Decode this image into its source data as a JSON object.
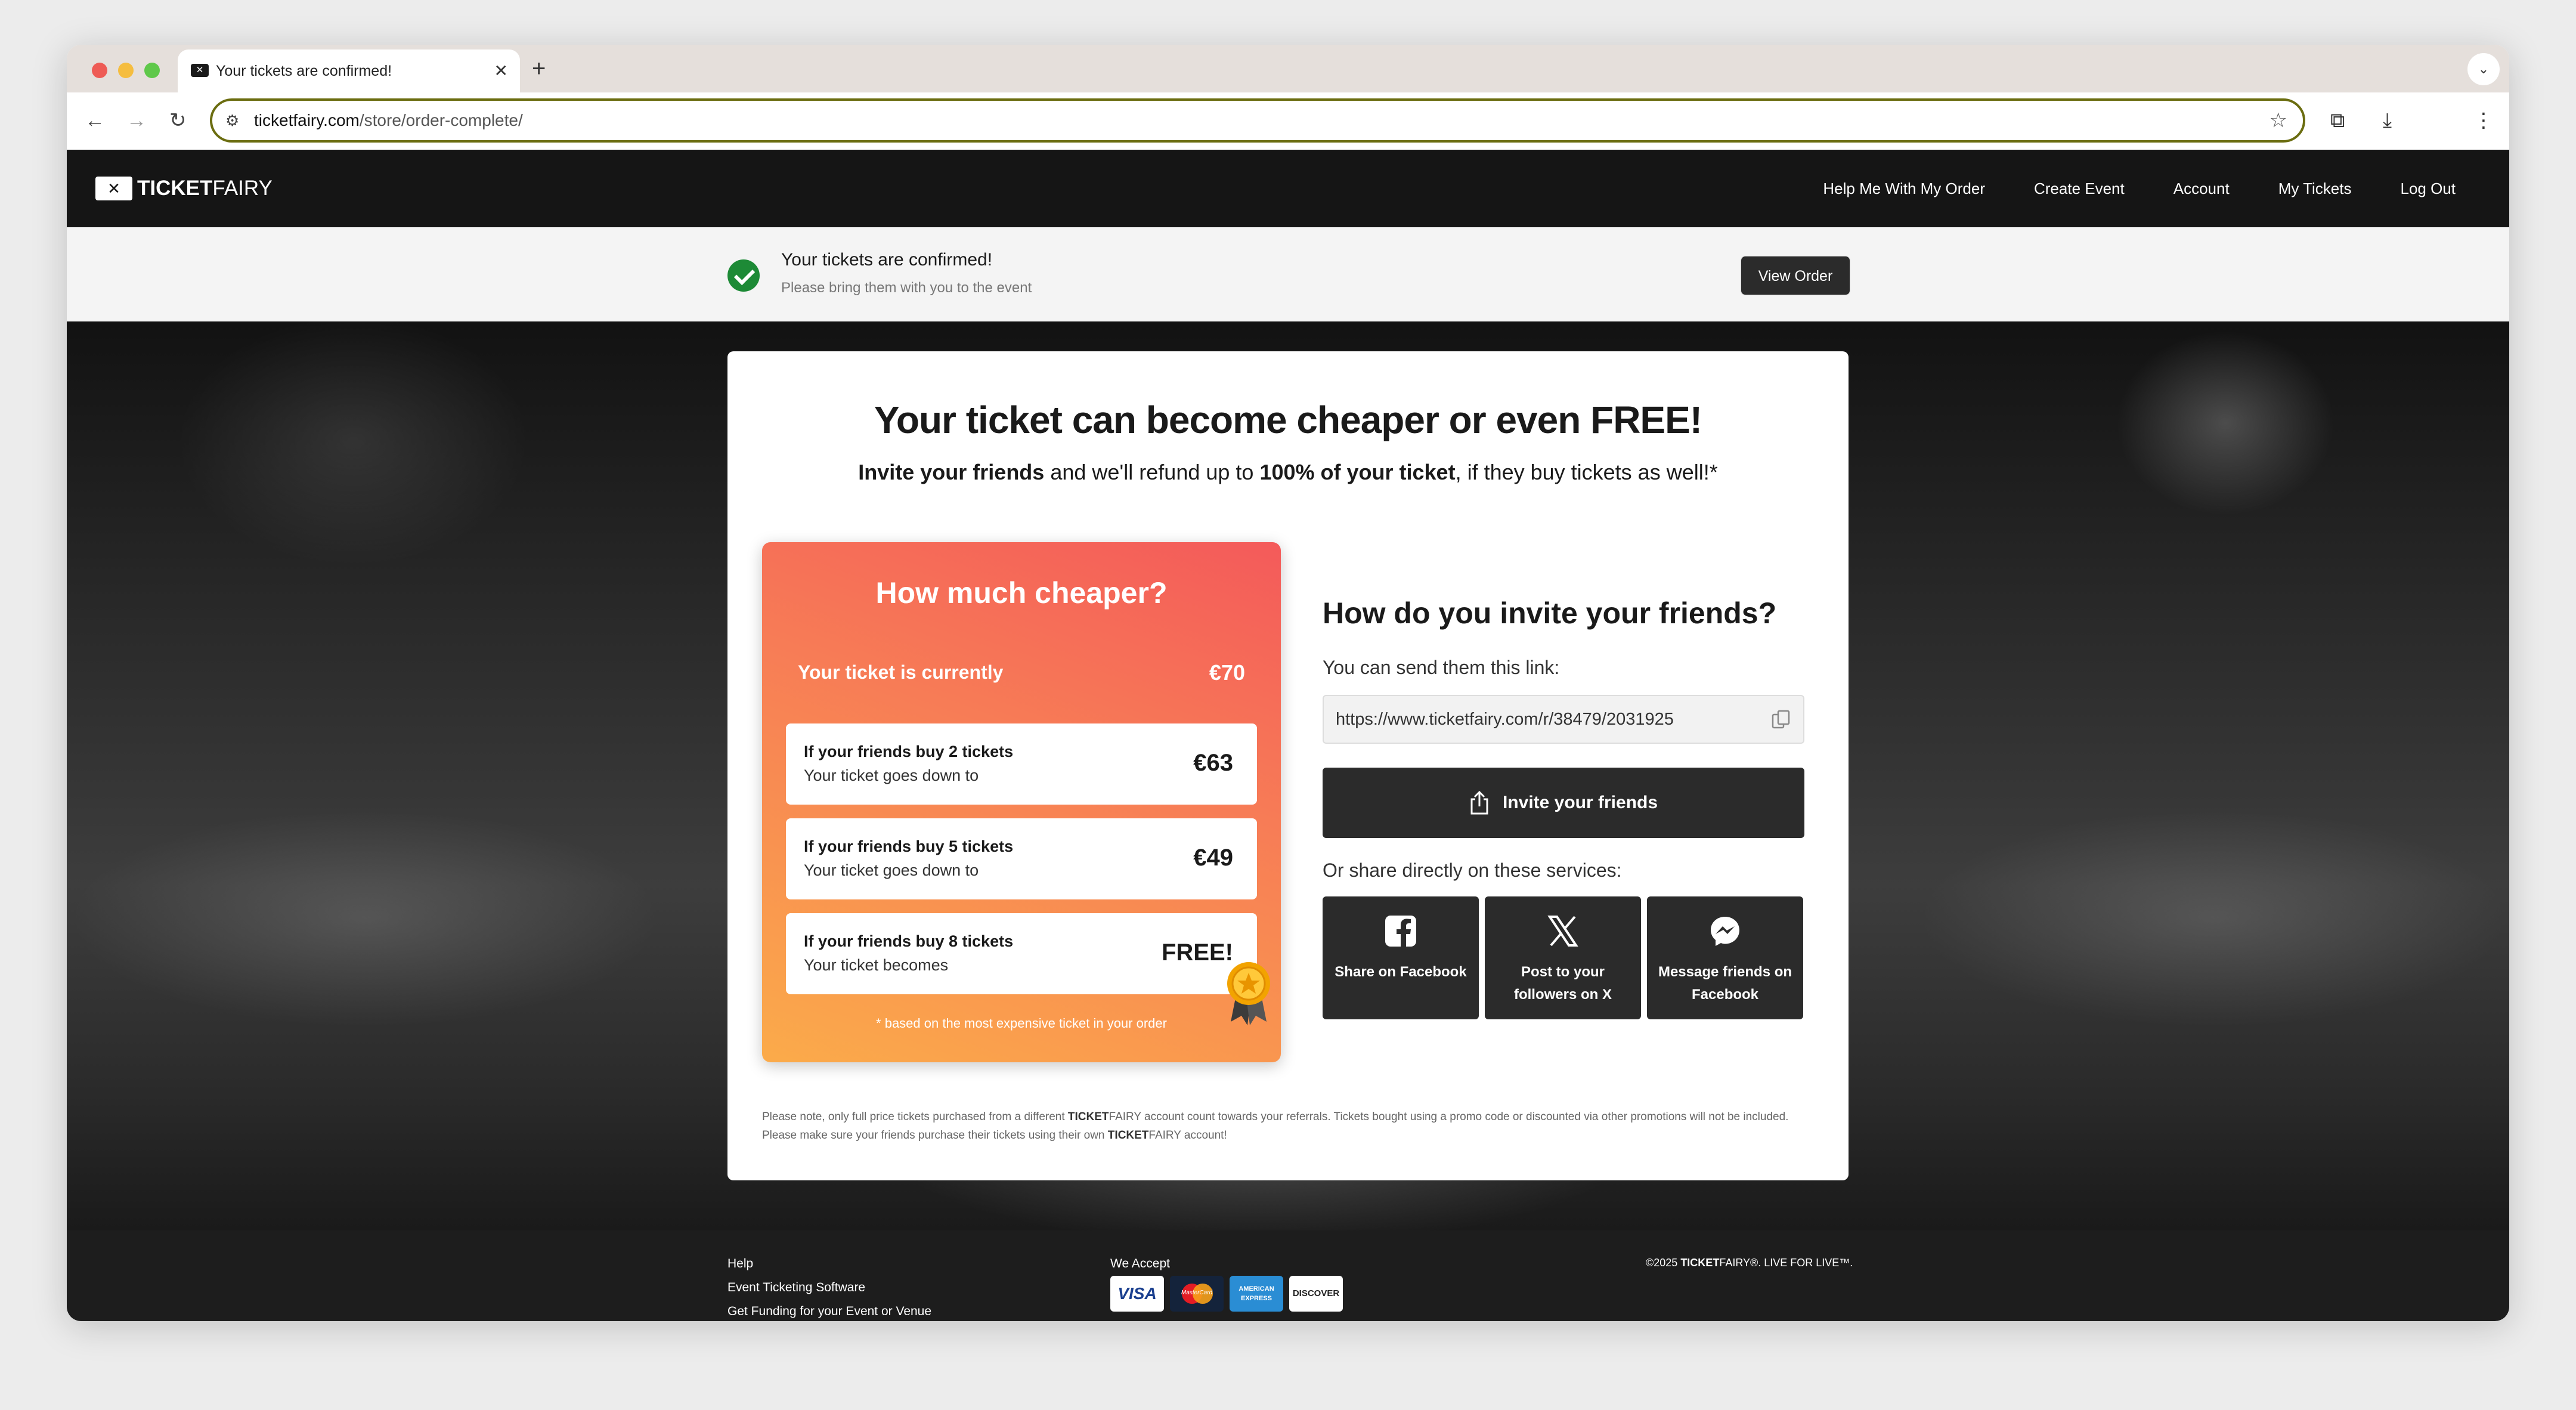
{
  "browser": {
    "tab_title": "Your tickets are confirmed!",
    "tab_favicon": "ticketfairy-logo",
    "url_host": "ticketfairy.com",
    "url_path": "/store/order-complete/",
    "icons": [
      "back-icon",
      "forward-icon",
      "reload-icon",
      "site-info-icon",
      "star-icon",
      "extensions-icon",
      "download-icon",
      "more-icon"
    ]
  },
  "header": {
    "logo_bold": "TICKET",
    "logo_light": "FAIRY",
    "nav": [
      "Help Me With My Order",
      "Create Event",
      "Account",
      "My Tickets",
      "Log Out"
    ]
  },
  "confirmation": {
    "title": "Your tickets are confirmed!",
    "subtitle": "Please bring them with you to the event",
    "button": "View Order",
    "icon": "check-circle-icon",
    "icon_color": "#1d8a36"
  },
  "promo": {
    "title": "Your ticket can become cheaper or even FREE!",
    "sub_b1": "Invite your friends",
    "sub_t1": " and we'll refund up to ",
    "sub_b2": "100% of your ticket",
    "sub_t2": ", if they buy tickets as well!*"
  },
  "cheaper": {
    "title": "How much cheaper?",
    "current_label": "Your ticket is currently",
    "current_price": "€70",
    "tiers": [
      {
        "line1": "If your friends buy 2 tickets",
        "line2": "Your ticket goes down to",
        "price": "€63"
      },
      {
        "line1": "If your friends buy 5 tickets",
        "line2": "Your ticket goes down to",
        "price": "€49"
      },
      {
        "line1": "If your friends buy 8 tickets",
        "line2": "Your ticket becomes",
        "price": "FREE!"
      }
    ],
    "footnote": "* based on the most expensive ticket in your order",
    "gradient_colors": [
      "#f45a5a",
      "#f77c56",
      "#fbab4a"
    ]
  },
  "invite": {
    "title": "How do you invite your friends?",
    "link_label": "You can send them this link:",
    "link_value": "https://www.ticketfairy.com/r/38479/2031925",
    "invite_button": "Invite your friends",
    "share_label": "Or share directly on these services:",
    "services": [
      {
        "label": "Share on Facebook",
        "icon": "facebook-icon"
      },
      {
        "label": "Post to your followers on X",
        "icon": "x-icon"
      },
      {
        "label": "Message friends on Facebook",
        "icon": "messenger-icon"
      }
    ]
  },
  "disclaimer": {
    "t1": "Please note, only full price tickets purchased from a different ",
    "b1": "TICKET",
    "t2": "FAIRY account count towards your referrals. Tickets bought using a promo code or discounted via other promotions will not be included. Please make sure your friends purchase their tickets using their own ",
    "b2": "TICKET",
    "t3": "FAIRY account!"
  },
  "footer": {
    "links": [
      "Help",
      "Event Ticketing Software",
      "Get Funding for your Event or Venue"
    ],
    "we_accept": "We Accept",
    "cards": [
      "VISA",
      "MasterCard",
      "AMERICAN EXPRESS",
      "DISCOVER"
    ],
    "copyright_prefix": "©2025 ",
    "copyright_brand_bold": "TICKET",
    "copyright_brand": "FAIRY®. LIVE FOR LIVE™."
  }
}
